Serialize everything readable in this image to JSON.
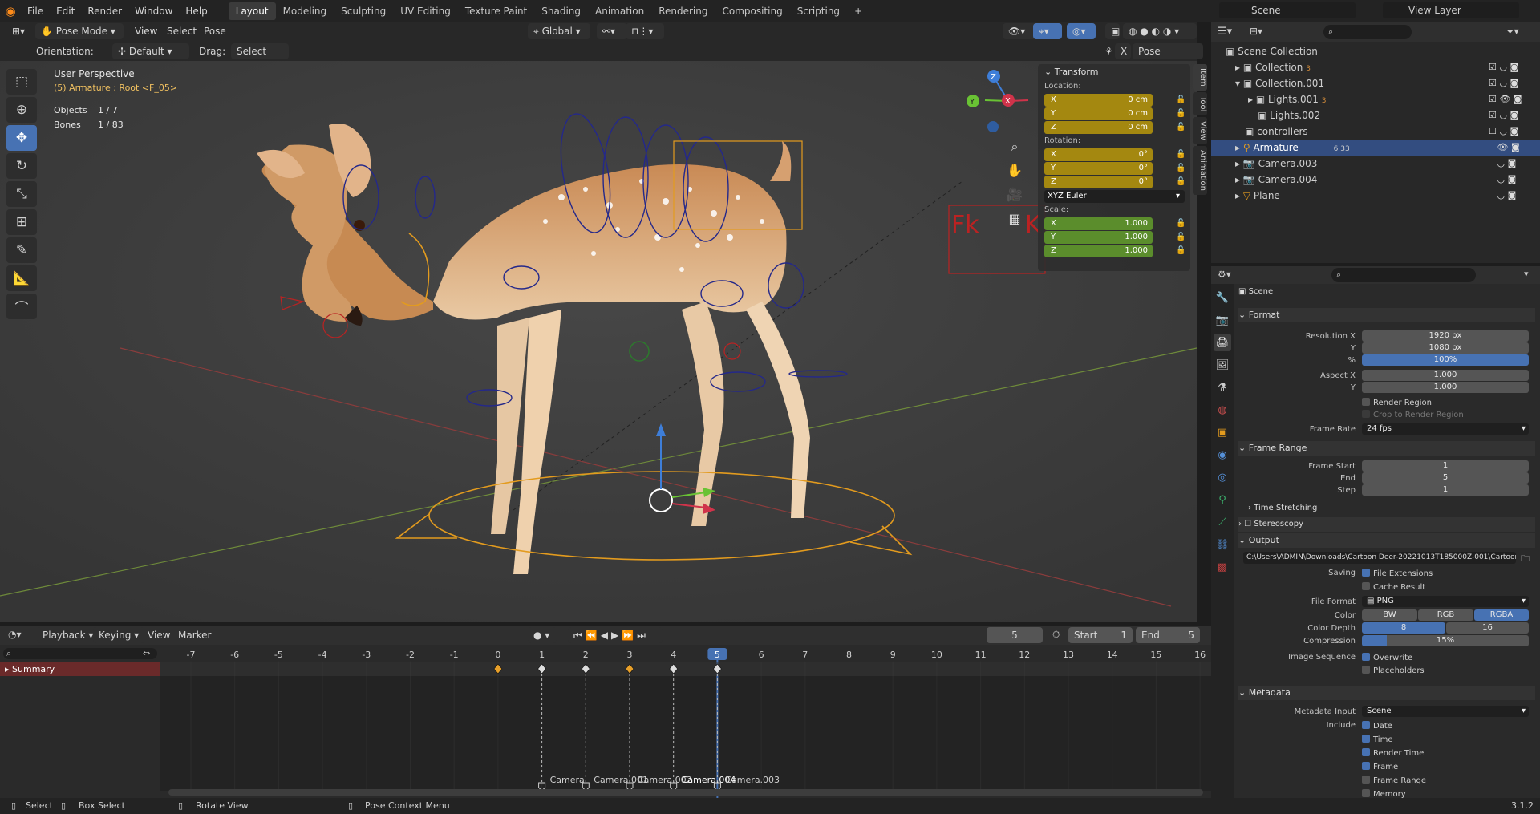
{
  "menu": [
    "File",
    "Edit",
    "Render",
    "Window",
    "Help"
  ],
  "workspaces": [
    "Layout",
    "Modeling",
    "Sculpting",
    "UV Editing",
    "Texture Paint",
    "Shading",
    "Animation",
    "Rendering",
    "Compositing",
    "Scripting"
  ],
  "workspace_add": "+",
  "scene_name": "Scene",
  "view_layer": "View Layer",
  "viewport_header": {
    "mode": "Pose Mode",
    "menus": [
      "View",
      "Select",
      "Pose"
    ],
    "transform_orientation": "Global",
    "orientation_label": "Orientation:",
    "orientation_value": "Default",
    "drag_label": "Drag:",
    "drag_value": "Select Box",
    "x_toggle": "X",
    "pose_options": "Pose Options"
  },
  "viewport": {
    "perspective": "User Perspective",
    "active": "(5) Armature : Root <F_05>",
    "objects_label": "Objects",
    "objects_value": "1 / 7",
    "bones_label": "Bones",
    "bones_value": "1 / 83",
    "fk_label": "Fk",
    "ik_label": "K"
  },
  "gizmo": {
    "x": "X",
    "y": "Y",
    "z": "Z"
  },
  "npanel": {
    "title": "Transform",
    "location_label": "Location:",
    "location": [
      {
        "axis": "X",
        "value": "0 cm"
      },
      {
        "axis": "Y",
        "value": "0 cm"
      },
      {
        "axis": "Z",
        "value": "0 cm"
      }
    ],
    "rotation_label": "Rotation:",
    "rotation": [
      {
        "axis": "X",
        "value": "0°"
      },
      {
        "axis": "Y",
        "value": "0°"
      },
      {
        "axis": "Z",
        "value": "0°"
      }
    ],
    "rotation_mode": "XYZ Euler",
    "scale_label": "Scale:",
    "scale": [
      {
        "axis": "X",
        "value": "1.000"
      },
      {
        "axis": "Y",
        "value": "1.000"
      },
      {
        "axis": "Z",
        "value": "1.000"
      }
    ],
    "tabs": [
      "Item",
      "Tool",
      "View",
      "Animation"
    ]
  },
  "outliner": {
    "root": "Scene Collection",
    "items": [
      {
        "name": "Collection",
        "badge": "3"
      },
      {
        "name": "Collection.001",
        "badge": ""
      },
      {
        "name": "Lights.001",
        "badge": "3"
      },
      {
        "name": "Lights.002",
        "badge": ""
      },
      {
        "name": "controllers",
        "badge": ""
      },
      {
        "name": "Armature",
        "badge": "6  33"
      },
      {
        "name": "Camera.003",
        "badge": ""
      },
      {
        "name": "Camera.004",
        "badge": ""
      },
      {
        "name": "Plane",
        "badge": ""
      }
    ]
  },
  "properties": {
    "context": "Scene",
    "format": {
      "title": "Format",
      "res_x_label": "Resolution X",
      "res_x": "1920 px",
      "res_y_label": "Y",
      "res_y": "1080 px",
      "pct_label": "%",
      "pct": "100%",
      "aspect_x_label": "Aspect X",
      "aspect_x": "1.000",
      "aspect_y_label": "Y",
      "aspect_y": "1.000",
      "render_region": "Render Region",
      "crop": "Crop to Render Region",
      "frame_rate_label": "Frame Rate",
      "frame_rate": "24 fps"
    },
    "frame_range": {
      "title": "Frame Range",
      "start_label": "Frame Start",
      "start": "1",
      "end_label": "End",
      "end": "5",
      "step_label": "Step",
      "step": "1"
    },
    "time_stretching": "Time Stretching",
    "stereoscopy": "Stereoscopy",
    "output": {
      "title": "Output",
      "path": "C:\\Users\\ADMIN\\Downloads\\Cartoon Deer-20221013T185000Z-001\\Cartoon Deer\\Re...",
      "saving_label": "Saving",
      "file_ext": "File Extensions",
      "cache": "Cache Result",
      "format_label": "File Format",
      "format": "PNG",
      "color_label": "Color",
      "color_opts": [
        "BW",
        "RGB",
        "RGBA"
      ],
      "depth_label": "Color Depth",
      "depth_opts": [
        "8",
        "16"
      ],
      "comp_label": "Compression",
      "comp": "15%",
      "seq_label": "Image Sequence",
      "overwrite": "Overwrite",
      "placeholders": "Placeholders"
    },
    "metadata": {
      "title": "Metadata",
      "input_label": "Metadata Input",
      "input": "Scene",
      "include_label": "Include",
      "items": [
        {
          "label": "Date",
          "on": true
        },
        {
          "label": "Time",
          "on": true
        },
        {
          "label": "Render Time",
          "on": true
        },
        {
          "label": "Frame",
          "on": true
        },
        {
          "label": "Frame Range",
          "on": false
        },
        {
          "label": "Memory",
          "on": false
        }
      ]
    }
  },
  "timeline": {
    "menus": [
      "Playback",
      "Keying",
      "View",
      "Marker"
    ],
    "current_frame": "5",
    "start_label": "Start",
    "start": "1",
    "end_label": "End",
    "end": "5",
    "summary": "Summary",
    "ticks": [
      "-7",
      "-6",
      "-5",
      "-4",
      "-3",
      "-2",
      "-1",
      "0",
      "1",
      "2",
      "3",
      "4",
      "5",
      "6",
      "7",
      "8",
      "9",
      "10",
      "11",
      "12",
      "13",
      "14",
      "15",
      "16"
    ],
    "keyframes": [
      0,
      1,
      2,
      3,
      4,
      5
    ],
    "markers": [
      "Camera",
      "Camera.001",
      "Camera.002",
      "Camera.004",
      "Camera.003"
    ]
  },
  "statusbar": {
    "items": [
      "Select",
      "Box Select",
      "Rotate View",
      "Pose Context Menu"
    ],
    "version": "3.1.2"
  }
}
